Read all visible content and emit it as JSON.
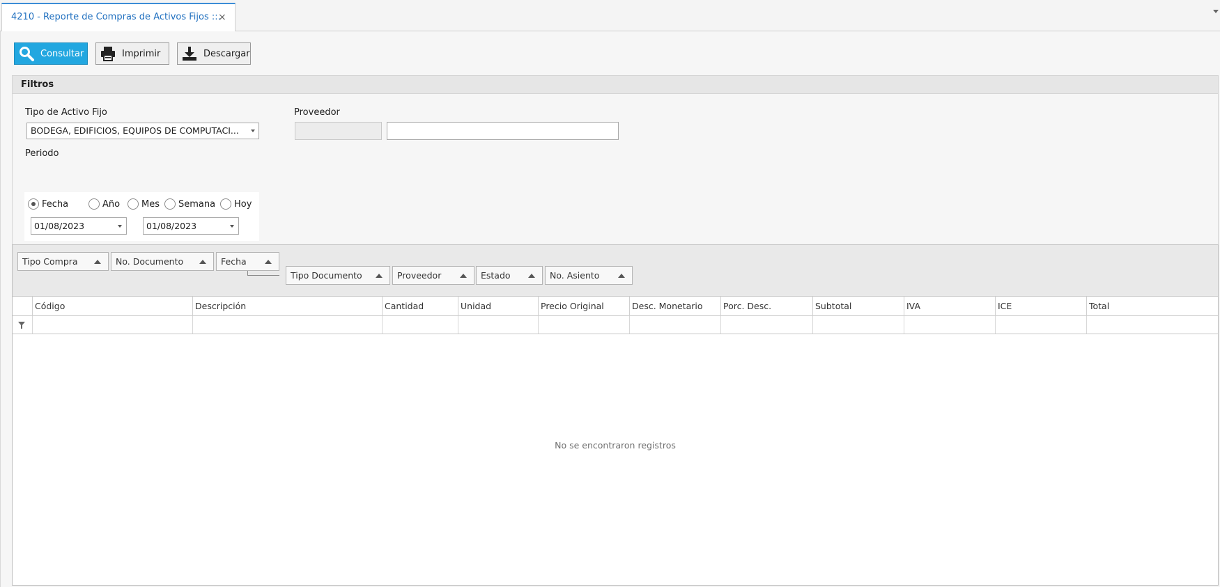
{
  "tab": {
    "title": "4210 - Reporte de Compras de Activos Fijos ::.",
    "close": "×"
  },
  "toolbar": {
    "consultar": "Consultar",
    "imprimir": "Imprimir",
    "descargar": "Descargar"
  },
  "filters": {
    "title": "Filtros",
    "tipo_activo_label": "Tipo de Activo Fijo",
    "tipo_activo_value": "BODEGA, EDIFICIOS, EQUIPOS DE COMPUTACI...",
    "proveedor_label": "Proveedor",
    "proveedor_code": "",
    "proveedor_name": "",
    "periodo_label": "Periodo",
    "periodo_options": [
      "Fecha",
      "Año",
      "Mes",
      "Semana",
      "Hoy"
    ],
    "periodo_selected": "Fecha",
    "date_from": "01/08/2023",
    "date_to": "01/08/2023"
  },
  "grid": {
    "group_by": [
      "Tipo Compra",
      "No. Documento",
      "Fecha",
      "Tipo Documento",
      "Proveedor",
      "Estado",
      "No. Asiento"
    ],
    "columns": [
      "Código",
      "Descripción",
      "Cantidad",
      "Unidad",
      "Precio Original",
      "Desc. Monetario",
      "Porc. Desc.",
      "Subtotal",
      "IVA",
      "ICE",
      "Total"
    ],
    "empty_text": "No se encontraron registros"
  },
  "colors": {
    "accent": "#22a7e0",
    "tab_text": "#1f6fbf"
  }
}
